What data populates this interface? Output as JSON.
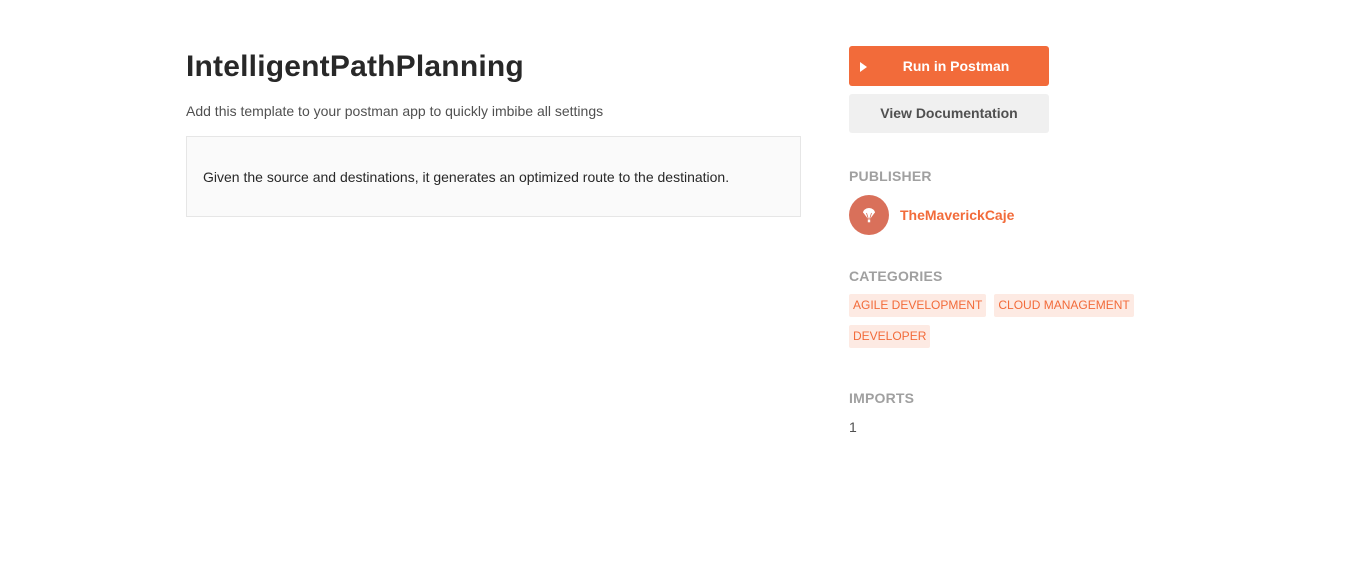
{
  "template": {
    "title": "IntelligentPathPlanning",
    "subtitle": "Add this template to your postman app to quickly imbibe all settings",
    "description": "Given the source and destinations, it generates an optimized route to the destination."
  },
  "actions": {
    "run_label": "Run in Postman",
    "run_icon": "play-icon",
    "docs_label": "View Documentation"
  },
  "publisher": {
    "heading": "PUBLISHER",
    "name": "TheMaverickCaje",
    "avatar_icon": "parachute-icon",
    "avatar_color": "#d9705a"
  },
  "categories": {
    "heading": "CATEGORIES",
    "items": [
      "AGILE DEVELOPMENT",
      "CLOUD MANAGEMENT",
      "DEVELOPER"
    ]
  },
  "imports": {
    "heading": "IMPORTS",
    "value": "1"
  },
  "colors": {
    "accent": "#f26b3a",
    "tag_background": "#fdeae3",
    "muted_label": "#a0a0a0"
  }
}
